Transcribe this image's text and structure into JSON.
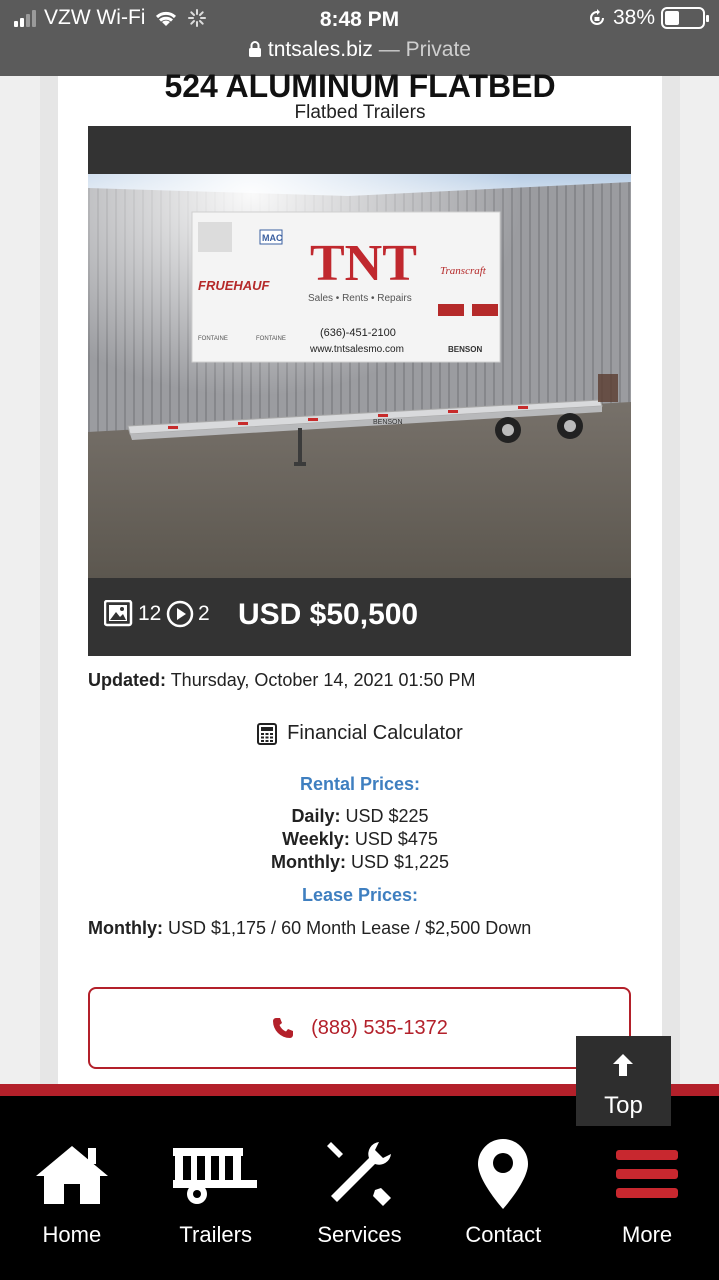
{
  "status_bar": {
    "carrier": "VZW Wi-Fi",
    "time": "8:48 PM",
    "battery": "38%"
  },
  "address_bar": {
    "domain": "tntsales.biz",
    "suffix": "— Private"
  },
  "listing": {
    "title": "524 ALUMINUM FLATBED",
    "category": "Flatbed Trailers",
    "photo_count": "12",
    "video_count": "2",
    "price": "USD $50,500",
    "updated_label": "Updated:",
    "updated_value": "Thursday, October 14, 2021 01:50 PM",
    "calculator_label": "Financial Calculator"
  },
  "photo_sign": {
    "logo": "TNT",
    "tagline": "Sales • Rents • Repairs",
    "phone": "(636)-451-2100",
    "url": "www.tntsalesmo.com",
    "brand_left": "FRUEHAUF",
    "brand_right": "Transcraft",
    "brand_mac": "MAC",
    "brand_small_1": "FONTAINE",
    "brand_small_2": "FONTAINE",
    "brand_benson": "BENSON",
    "trailer_brand": "BENSON"
  },
  "rental": {
    "heading": "Rental Prices:",
    "daily_label": "Daily:",
    "daily_value": "USD $225",
    "weekly_label": "Weekly:",
    "weekly_value": "USD $475",
    "monthly_label": "Monthly:",
    "monthly_value": "USD $1,225"
  },
  "lease": {
    "heading": "Lease Prices:",
    "monthly_label": "Monthly:",
    "monthly_value": "USD $1,175 / 60 Month Lease / $2,500 Down"
  },
  "contact": {
    "phone": "(888) 535-1372"
  },
  "top_button": {
    "label": "Top"
  },
  "bottom_nav": {
    "items": [
      {
        "label": "Home",
        "icon": "home-icon"
      },
      {
        "label": "Trailers",
        "icon": "trailer-icon"
      },
      {
        "label": "Services",
        "icon": "tools-icon"
      },
      {
        "label": "Contact",
        "icon": "map-pin-icon"
      },
      {
        "label": "More",
        "icon": "menu-icon"
      }
    ]
  },
  "colors": {
    "accent_red": "#b3202a",
    "link_blue": "#3f7fc0",
    "dark_bar": "#333333"
  }
}
